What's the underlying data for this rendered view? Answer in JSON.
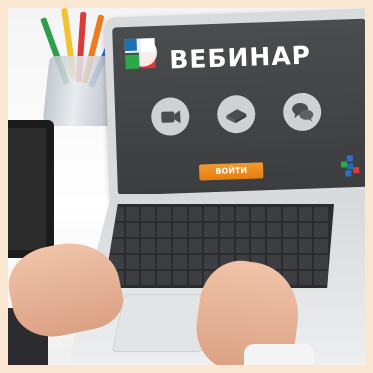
{
  "screen": {
    "title": "ВЕБИНАР",
    "login_button": "ВОЙТИ",
    "icons": [
      "video-camera-icon",
      "book-icon",
      "chat-bubbles-icon"
    ]
  },
  "colors": {
    "frame": "#fbe6d2",
    "screen_bg": "#434547",
    "accent_orange": "#f08a1e",
    "logo_blue": "#1f6fb5",
    "logo_green": "#2aa84a",
    "logo_red": "#e03a3a"
  }
}
